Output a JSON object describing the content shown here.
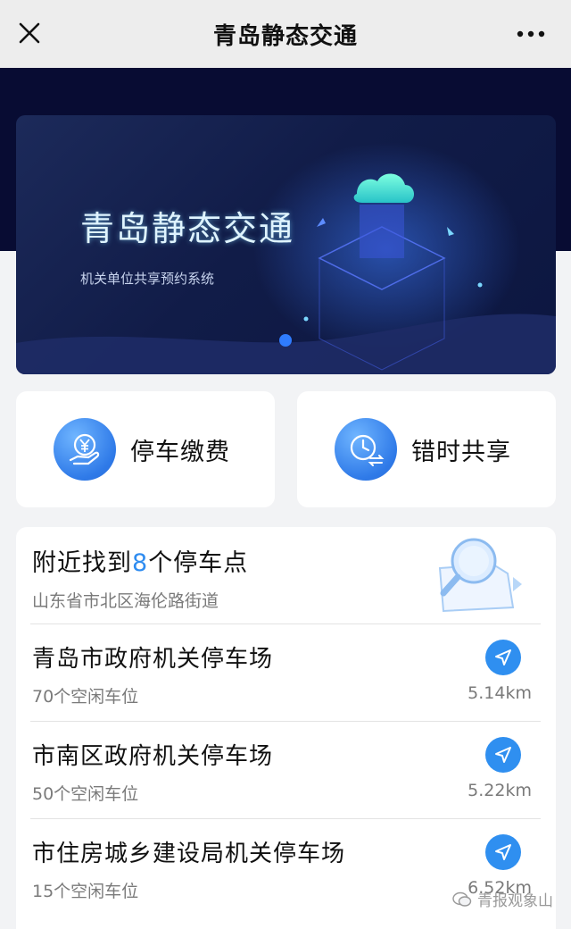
{
  "header": {
    "title": "青岛静态交通"
  },
  "banner": {
    "title": "青岛静态交通",
    "subtitle": "机关单位共享预约系统"
  },
  "actions": [
    {
      "label": "停车缴费",
      "icon": "yen-hand-icon"
    },
    {
      "label": "错时共享",
      "icon": "clock-arrows-icon"
    }
  ],
  "nearby": {
    "prefix": "附近找到",
    "count": "8",
    "suffix": "个停车点",
    "address": "山东省市北区海伦路街道"
  },
  "lots": [
    {
      "name": "青岛市政府机关停车场",
      "free": "70个空闲车位",
      "distance": "5.14km"
    },
    {
      "name": "市南区政府机关停车场",
      "free": "50个空闲车位",
      "distance": "5.22km"
    },
    {
      "name": "市住房城乡建设局机关停车场",
      "free": "15个空闲车位",
      "distance": "6.52km"
    }
  ],
  "watermark": "青报观象山",
  "colors": {
    "accent": "#2f8cf0",
    "darkband": "#080c33"
  }
}
